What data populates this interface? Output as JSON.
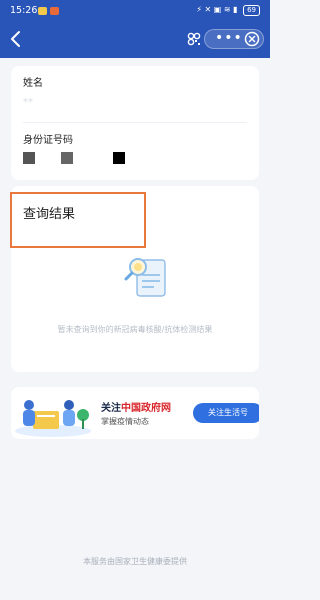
{
  "status_bar": {
    "time": "15:26",
    "right_icons": "⚡ ✕ ▣ ≋ ▮",
    "battery": "69"
  },
  "nav": {
    "back_icon": "chevron-left-icon",
    "scan_icon": "scan-icon",
    "more_label": "•••",
    "close_icon": "close-circle-icon"
  },
  "form": {
    "name_label": "姓名",
    "name_value": "**",
    "id_label": "身份证号码"
  },
  "result": {
    "title": "查询结果",
    "empty_message": "暂未查询到你的新冠病毒核酸/抗体检测结果"
  },
  "banner": {
    "title_prefix": "关注",
    "title_highlight": "中国政府网",
    "subtitle": "掌握疫情动态",
    "button_label": "关注生活号"
  },
  "footer": {
    "text": "本服务由国家卫生健康委提供"
  },
  "colors": {
    "header_bg": "#2a55b8",
    "accent": "#2f6fe0",
    "highlight_box": "#e8783c",
    "brand_red": "#d8262c"
  }
}
